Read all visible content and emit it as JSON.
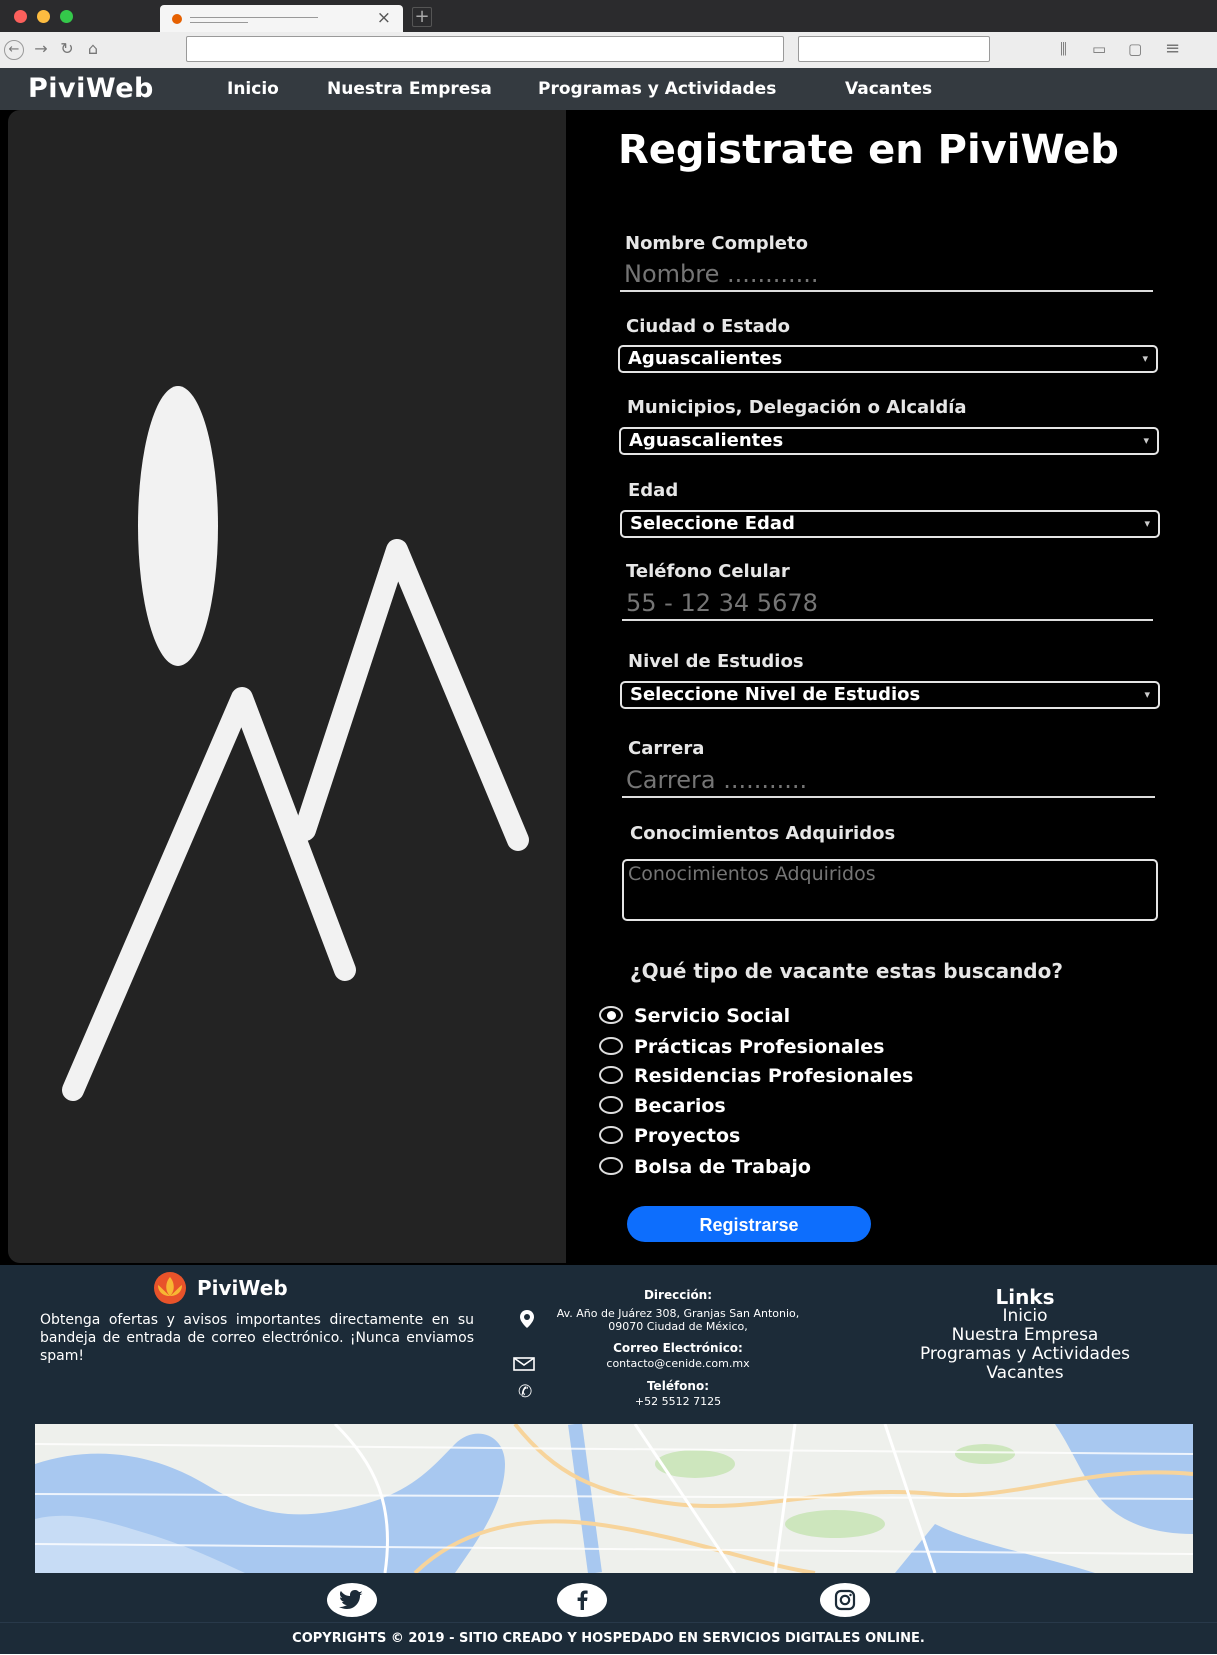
{
  "nav": {
    "brand": "PiviWeb",
    "links": [
      "Inicio",
      "Nuestra Empresa",
      "Programas y Actividades",
      "Vacantes"
    ]
  },
  "form": {
    "title": "Registrate en PiviWeb",
    "name_label": "Nombre Completo",
    "name_placeholder": "Nombre ............",
    "city_label": "Ciudad o Estado",
    "city_value": "Aguascalientes",
    "municipality_label": "Municipios, Delegación o Alcaldía",
    "municipality_value": "Aguascalientes",
    "age_label": "Edad",
    "age_value": "Seleccione Edad",
    "phone_label": "Teléfono Celular",
    "phone_placeholder": "55 - 12 34 5678",
    "education_label": "Nivel de Estudios",
    "education_value": "Seleccione Nivel de Estudios",
    "career_label": "Carrera",
    "career_placeholder": "Carrera ...........",
    "knowledge_label": "Conocimientos Adquiridos",
    "knowledge_placeholder": "Conocimientos Adquiridos",
    "vacancy_question": "¿Qué tipo de vacante estas buscando?",
    "vacancy_options": [
      "Servicio Social",
      "Prácticas Profesionales",
      "Residencias Profesionales",
      "Becarios",
      "Proyectos",
      "Bolsa de Trabajo"
    ],
    "vacancy_selected": "Servicio Social",
    "submit_label": "Registrarse"
  },
  "footer": {
    "brand": "PiviWeb",
    "newsletter_text": "Obtenga ofertas y avisos importantes directamente en su bandeja de entrada de correo electrónico. ¡Nunca enviamos spam!",
    "address_label": "Dirección:",
    "address": "Av. Año de Juárez 308, Granjas San Antonio, 09070 Ciudad de México,",
    "email_label": "Correo Electrónico:",
    "email": "contacto@cenide.com.mx",
    "phone_label": "Teléfono:",
    "phone": "+52 5512 7125",
    "links_title": "Links",
    "links": [
      "Inicio",
      "Nuestra Empresa",
      "Programas y Actividades",
      "Vacantes"
    ],
    "social": [
      "twitter-icon",
      "facebook-icon",
      "instagram-icon"
    ],
    "copyright": "COPYRIGHTS © 2019 - SITIO CREADO Y HOSPEDADO EN SERVICIOS DIGITALES ONLINE."
  },
  "colors": {
    "navbar": "#343a40",
    "footer": "#1c2b38",
    "button": "#0d6efd",
    "form_bg": "#000000",
    "image_placeholder": "#232323"
  }
}
